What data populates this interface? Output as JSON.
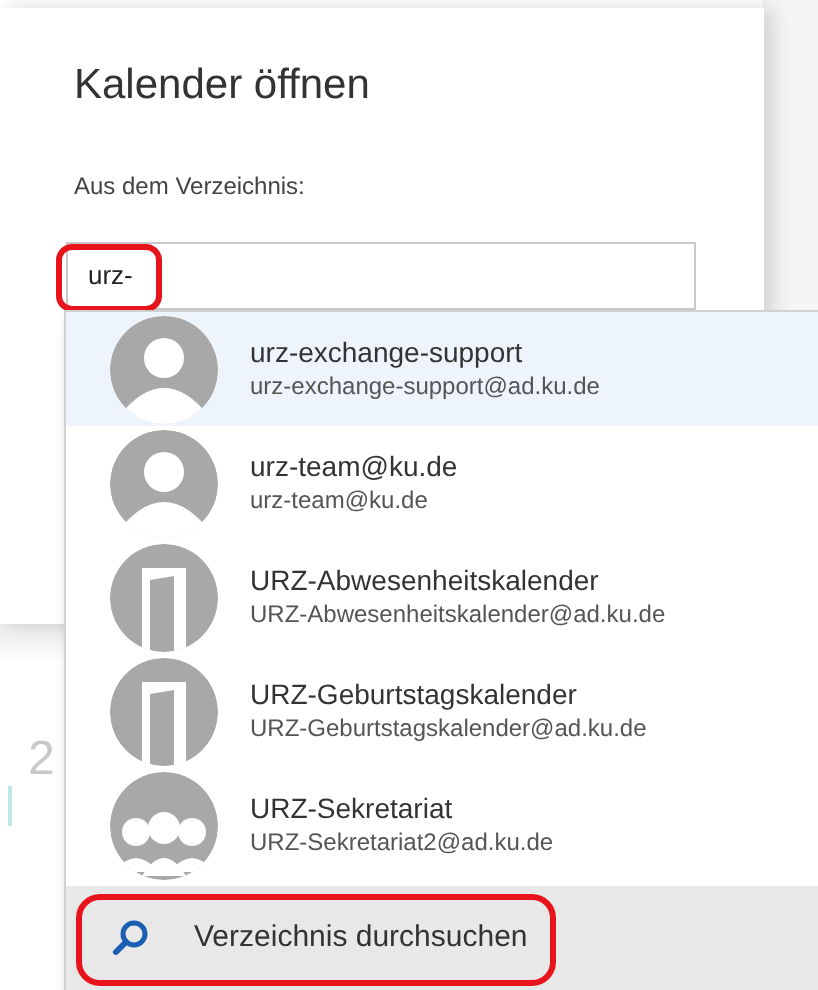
{
  "dialog": {
    "title": "Kalender öffnen",
    "field_label": "Aus dem Verzeichnis:",
    "field_value": "urz-"
  },
  "background_text": "2",
  "suggestions": [
    {
      "kind": "person",
      "name": "urz-exchange-support",
      "email": "urz-exchange-support@ad.ku.de",
      "selected": true
    },
    {
      "kind": "person",
      "name": "urz-team@ku.de",
      "email": "urz-team@ku.de",
      "selected": false
    },
    {
      "kind": "room",
      "name": "URZ-Abwesenheitskalender",
      "email": "URZ-Abwesenheitskalender@ad.ku.de",
      "selected": false
    },
    {
      "kind": "room",
      "name": "URZ-Geburtstagskalender",
      "email": "URZ-Geburtstagskalender@ad.ku.de",
      "selected": false
    },
    {
      "kind": "group",
      "name": "URZ-Sekretariat",
      "email": "URZ-Sekretariat2@ad.ku.de",
      "selected": false
    }
  ],
  "search_directory": {
    "label": "Verzeichnis durchsuchen"
  }
}
